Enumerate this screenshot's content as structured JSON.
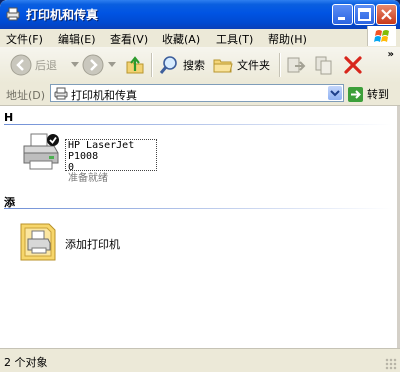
{
  "window": {
    "title": "打印机和传真"
  },
  "menubar": {
    "items": [
      {
        "label": "文件(F)"
      },
      {
        "label": "编辑(E)"
      },
      {
        "label": "查看(V)"
      },
      {
        "label": "收藏(A)"
      },
      {
        "label": "工具(T)"
      },
      {
        "label": "帮助(H)"
      }
    ]
  },
  "toolbar": {
    "back_label": "后退",
    "search_label": "搜索",
    "folders_label": "文件夹",
    "overflow": "»"
  },
  "addressbar": {
    "label": "地址(D)",
    "value": "打印机和传真",
    "go_label": "转到"
  },
  "content": {
    "groups": [
      {
        "heading": "H"
      },
      {
        "heading": "添"
      }
    ],
    "printer": {
      "name": "HP LaserJet P1008",
      "count": "0",
      "status": "准备就绪"
    },
    "add_printer": {
      "label": "添加打印机"
    }
  },
  "statusbar": {
    "text": "2 个对象"
  },
  "colors": {
    "titlebar_blue": "#0054e3",
    "close_red": "#c8381b",
    "window_face": "#ece9d8"
  }
}
